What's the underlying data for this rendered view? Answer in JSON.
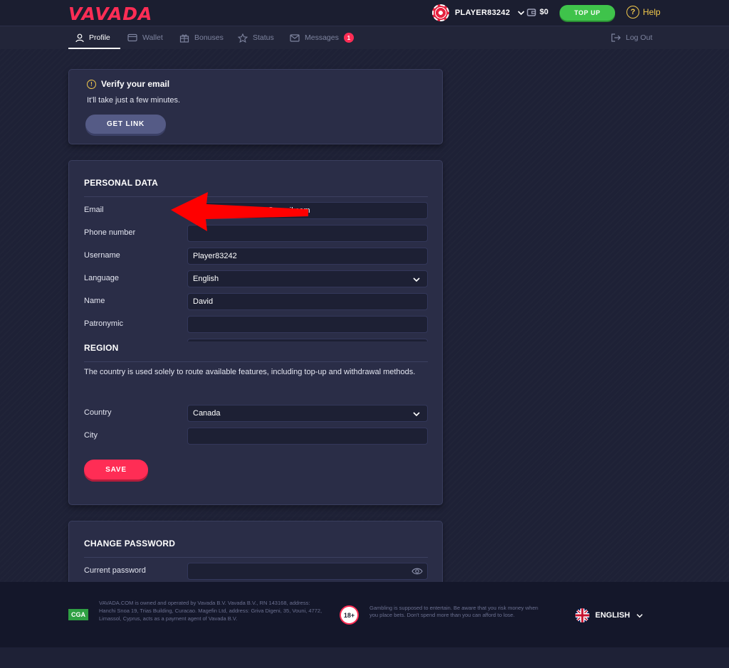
{
  "brand": {
    "logo_text": "VAVADA",
    "accent": "#ff2d55"
  },
  "header": {
    "username": "PLAYER83242",
    "balance": "$0",
    "topup_label": "TOP UP",
    "help_label": "Help"
  },
  "nav": {
    "items": [
      {
        "label": "Profile",
        "icon": "user-icon"
      },
      {
        "label": "Wallet",
        "icon": "wallet-icon"
      },
      {
        "label": "Bonuses",
        "icon": "gift-icon"
      },
      {
        "label": "Status",
        "icon": "star-icon"
      },
      {
        "label": "Messages",
        "icon": "mail-icon",
        "badge": "1"
      }
    ],
    "logout_label": "Log Out"
  },
  "verify": {
    "title": "Verify your email",
    "subtitle": "It'll take just a few minutes.",
    "button": "GET LINK"
  },
  "personal": {
    "title": "PERSONAL DATA",
    "fields": [
      {
        "label": "Email",
        "value": "81@gmail.com"
      },
      {
        "label": "Phone number",
        "value": ""
      },
      {
        "label": "Username",
        "value": "Player83242"
      },
      {
        "label": "Language",
        "value": "English"
      },
      {
        "label": "Name",
        "value": "David"
      },
      {
        "label": "Patronymic",
        "value": ""
      }
    ]
  },
  "region": {
    "title": "REGION",
    "description": "The country is used solely to route available features, including top-up and withdrawal methods.",
    "country_label": "Country",
    "country_value": "Canada",
    "city_label": "City",
    "city_value": "",
    "save_label": "SAVE"
  },
  "password": {
    "title": "CHANGE PASSWORD",
    "current_label": "Current password"
  },
  "footer": {
    "cga_text": "CGA",
    "legal": "VAVADA.COM is owned and operated by Vavada B.V. Vavada B.V., RN 143168, address: Hanchi Snoa 19, Trias Building, Curacao. Magefin Ltd, address: Griva Digeni, 35, Vouni, 4772, Limassol, Cyprus, acts as a payment agent of Vavada B.V.",
    "age": "18+",
    "gambling": "Gambling is supposed to entertain. Be aware that you risk money when you place bets. Don't spend more than you can afford to lose.",
    "language": "ENGLISH"
  }
}
